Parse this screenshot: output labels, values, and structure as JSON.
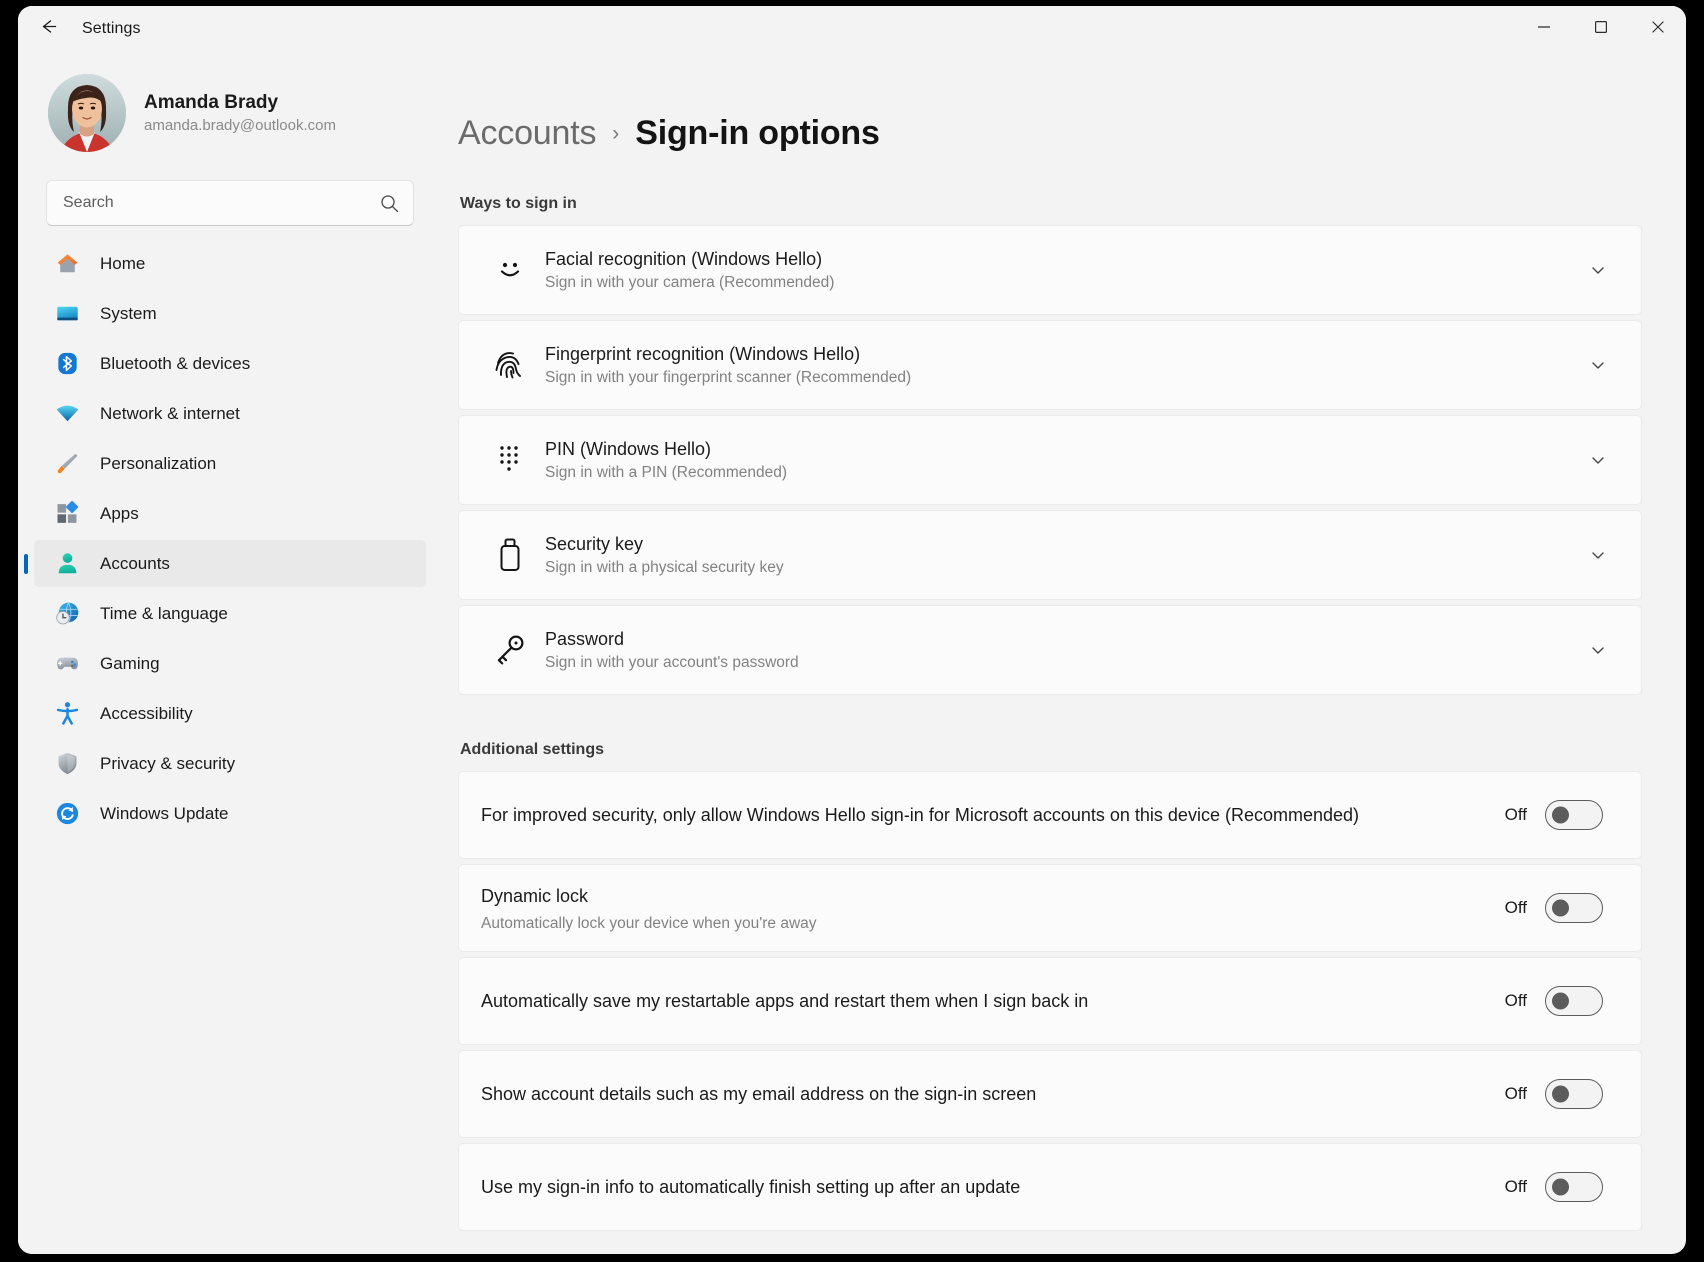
{
  "window": {
    "title": "Settings",
    "back_icon": "back-arrow-icon",
    "minimize_label": "—",
    "maximize_label": "□",
    "close_label": "✕"
  },
  "sidebar": {
    "profile": {
      "name": "Amanda Brady",
      "email": "amanda.brady@outlook.com"
    },
    "search": {
      "placeholder": "Search",
      "value": "",
      "icon": "search-icon"
    },
    "items": [
      {
        "label": "Home",
        "icon": "home-icon",
        "selected": false
      },
      {
        "label": "System",
        "icon": "monitor-icon",
        "selected": false
      },
      {
        "label": "Bluetooth & devices",
        "icon": "bluetooth-icon",
        "selected": false
      },
      {
        "label": "Network & internet",
        "icon": "wifi-icon",
        "selected": false
      },
      {
        "label": "Personalization",
        "icon": "paintbrush-icon",
        "selected": false
      },
      {
        "label": "Apps",
        "icon": "apps-icon",
        "selected": false
      },
      {
        "label": "Accounts",
        "icon": "person-icon",
        "selected": true
      },
      {
        "label": "Time & language",
        "icon": "clock-globe-icon",
        "selected": false
      },
      {
        "label": "Gaming",
        "icon": "gamepad-icon",
        "selected": false
      },
      {
        "label": "Accessibility",
        "icon": "accessibility-icon",
        "selected": false
      },
      {
        "label": "Privacy & security",
        "icon": "shield-icon",
        "selected": false
      },
      {
        "label": "Windows Update",
        "icon": "update-refresh-icon",
        "selected": false
      }
    ]
  },
  "main": {
    "breadcrumb": {
      "parent": "Accounts",
      "separator": "›",
      "current": "Sign-in options"
    },
    "ways_section": {
      "heading": "Ways to sign in",
      "items": [
        {
          "title": "Facial recognition (Windows Hello)",
          "subtitle": "Sign in with your camera (Recommended)",
          "icon": "face-smile-icon",
          "chevron": "chevron-down-icon"
        },
        {
          "title": "Fingerprint recognition (Windows Hello)",
          "subtitle": "Sign in with your fingerprint scanner (Recommended)",
          "icon": "fingerprint-icon",
          "chevron": "chevron-down-icon"
        },
        {
          "title": "PIN (Windows Hello)",
          "subtitle": "Sign in with a PIN (Recommended)",
          "icon": "pin-keypad-icon",
          "chevron": "chevron-down-icon"
        },
        {
          "title": "Security key",
          "subtitle": "Sign in with a physical security key",
          "icon": "usb-security-key-icon",
          "chevron": "chevron-down-icon"
        },
        {
          "title": "Password",
          "subtitle": "Sign in with your account's password",
          "icon": "key-icon",
          "chevron": "chevron-down-icon"
        }
      ]
    },
    "additional_section": {
      "heading": "Additional settings",
      "items": [
        {
          "title": "For improved security, only allow Windows Hello sign-in for Microsoft accounts on this device (Recommended)",
          "subtitle": "",
          "toggle_label": "Off",
          "toggle_on": false
        },
        {
          "title": "Dynamic lock",
          "subtitle": "Automatically lock your device when you're away",
          "toggle_label": "Off",
          "toggle_on": false
        },
        {
          "title": "Automatically save my restartable apps and restart them when I sign back in",
          "subtitle": "",
          "toggle_label": "Off",
          "toggle_on": false
        },
        {
          "title": "Show account details such as my email address on the sign-in screen",
          "subtitle": "",
          "toggle_label": "Off",
          "toggle_on": false
        },
        {
          "title": "Use my sign-in info to automatically finish setting up after an update",
          "subtitle": "",
          "toggle_label": "Off",
          "toggle_on": false
        }
      ]
    }
  },
  "colors": {
    "accent": "#0067C0",
    "window_bg": "#F3F3F3",
    "card_bg": "#FBFBFB",
    "selected_nav_bg": "#E9E9E9"
  }
}
